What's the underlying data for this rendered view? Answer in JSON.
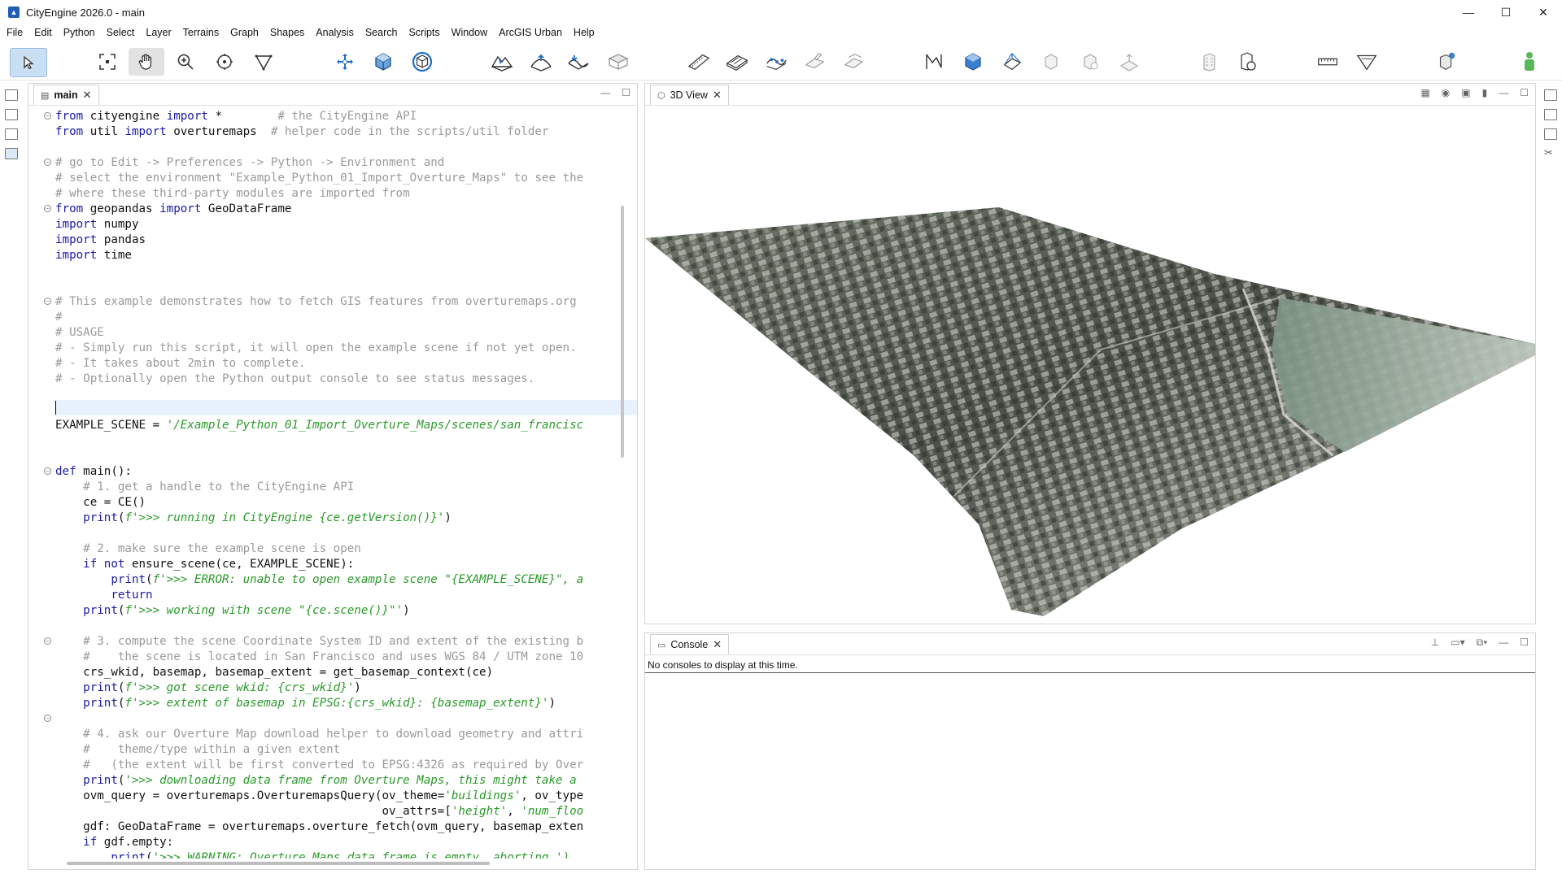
{
  "window": {
    "title": "CityEngine 2026.0 - main"
  },
  "menu": [
    "File",
    "Edit",
    "Python",
    "Select",
    "Layer",
    "Terrains",
    "Graph",
    "Shapes",
    "Analysis",
    "Search",
    "Scripts",
    "Window",
    "ArcGIS Urban",
    "Help"
  ],
  "editor": {
    "tab_label": "main",
    "lines": [
      [
        {
          "t": "from ",
          "c": "kw"
        },
        {
          "t": "cityengine ",
          "c": ""
        },
        {
          "t": "import",
          "c": "kw"
        },
        {
          "t": " *        ",
          "c": ""
        },
        {
          "t": "# the CityEngine API",
          "c": "cm"
        }
      ],
      [
        {
          "t": "from ",
          "c": "kw"
        },
        {
          "t": "util ",
          "c": ""
        },
        {
          "t": "import",
          "c": "kw"
        },
        {
          "t": " overturemaps  ",
          "c": ""
        },
        {
          "t": "# helper code in the scripts/util folder",
          "c": "cm"
        }
      ],
      [],
      [
        {
          "t": "# go to Edit -> Preferences -> Python -> Environment and",
          "c": "cm"
        }
      ],
      [
        {
          "t": "# select the environment \"Example_Python_01_Import_Overture_Maps\" to see the",
          "c": "cm"
        }
      ],
      [
        {
          "t": "# where these third-party modules are imported from",
          "c": "cm"
        }
      ],
      [
        {
          "t": "from ",
          "c": "kw"
        },
        {
          "t": "geopandas ",
          "c": ""
        },
        {
          "t": "import",
          "c": "kw"
        },
        {
          "t": " GeoDataFrame",
          "c": ""
        }
      ],
      [
        {
          "t": "import",
          "c": "kw"
        },
        {
          "t": " numpy",
          "c": ""
        }
      ],
      [
        {
          "t": "import",
          "c": "kw"
        },
        {
          "t": " pandas",
          "c": ""
        }
      ],
      [
        {
          "t": "import",
          "c": "kw"
        },
        {
          "t": " time",
          "c": ""
        }
      ],
      [],
      [],
      [
        {
          "t": "# This example demonstrates how to fetch GIS features from overturemaps.org",
          "c": "cm"
        }
      ],
      [
        {
          "t": "#",
          "c": "cm"
        }
      ],
      [
        {
          "t": "# USAGE",
          "c": "cm"
        }
      ],
      [
        {
          "t": "# - Simply run this script, it will open the example scene if not yet open.",
          "c": "cm"
        }
      ],
      [
        {
          "t": "# - It takes about 2min to complete.",
          "c": "cm"
        }
      ],
      [
        {
          "t": "# - Optionally open the Python output console to see status messages.",
          "c": "cm"
        }
      ],
      [],
      [],
      [
        {
          "t": "EXAMPLE_SCENE = ",
          "c": ""
        },
        {
          "t": "'/Example_Python_01_Import_Overture_Maps/scenes/san_francisc",
          "c": "str"
        }
      ],
      [],
      [],
      [
        {
          "t": "def ",
          "c": "kw"
        },
        {
          "t": "main():",
          "c": ""
        }
      ],
      [
        {
          "t": "    # 1. get a handle to the CityEngine API",
          "c": "cm"
        }
      ],
      [
        {
          "t": "    ce = CE()",
          "c": ""
        }
      ],
      [
        {
          "t": "    print",
          "c": "df"
        },
        {
          "t": "(",
          "c": ""
        },
        {
          "t": "f'>>> running in CityEngine {ce.getVersion()}'",
          "c": "str"
        },
        {
          "t": ")",
          "c": ""
        }
      ],
      [],
      [
        {
          "t": "    # 2. make sure the example scene is open",
          "c": "cm"
        }
      ],
      [
        {
          "t": "    if not ",
          "c": "kw"
        },
        {
          "t": "ensure_scene(ce, EXAMPLE_SCENE):",
          "c": ""
        }
      ],
      [
        {
          "t": "        print",
          "c": "df"
        },
        {
          "t": "(",
          "c": ""
        },
        {
          "t": "f'>>> ERROR: unable to open example scene \"{EXAMPLE_SCENE}\", a",
          "c": "str"
        }
      ],
      [
        {
          "t": "        return",
          "c": "kw"
        }
      ],
      [
        {
          "t": "    print",
          "c": "df"
        },
        {
          "t": "(",
          "c": ""
        },
        {
          "t": "f'>>> working with scene \"{ce.scene()}\"'",
          "c": "str"
        },
        {
          "t": ")",
          "c": ""
        }
      ],
      [],
      [
        {
          "t": "    # 3. compute the scene Coordinate System ID and extent of the existing b",
          "c": "cm"
        }
      ],
      [
        {
          "t": "    #    the scene is located in San Francisco and uses WGS 84 / UTM zone 10",
          "c": "cm"
        }
      ],
      [
        {
          "t": "    crs_wkid, basemap, basemap_extent = get_basemap_context(ce)",
          "c": ""
        }
      ],
      [
        {
          "t": "    print",
          "c": "df"
        },
        {
          "t": "(",
          "c": ""
        },
        {
          "t": "f'>>> got scene wkid: {crs_wkid}'",
          "c": "str"
        },
        {
          "t": ")",
          "c": ""
        }
      ],
      [
        {
          "t": "    print",
          "c": "df"
        },
        {
          "t": "(",
          "c": ""
        },
        {
          "t": "f'>>> extent of basemap in EPSG:{crs_wkid}: {basemap_extent}'",
          "c": "str"
        },
        {
          "t": ")",
          "c": ""
        }
      ],
      [],
      [
        {
          "t": "    # 4. ask our Overture Map download helper to download geometry and attri",
          "c": "cm"
        }
      ],
      [
        {
          "t": "    #    theme/type within a given extent",
          "c": "cm"
        }
      ],
      [
        {
          "t": "    #   (the extent will be first converted to EPSG:4326 as required by Over",
          "c": "cm"
        }
      ],
      [
        {
          "t": "    print",
          "c": "df"
        },
        {
          "t": "(",
          "c": ""
        },
        {
          "t": "'>>> downloading data frame from Overture Maps, this might take a",
          "c": "str"
        }
      ],
      [
        {
          "t": "    ovm_query = overturemaps.OverturemapsQuery(ov_theme=",
          "c": ""
        },
        {
          "t": "'buildings'",
          "c": "str"
        },
        {
          "t": ", ov_type",
          "c": ""
        }
      ],
      [
        {
          "t": "                                               ov_attrs=[",
          "c": ""
        },
        {
          "t": "'height'",
          "c": "str"
        },
        {
          "t": ", ",
          "c": ""
        },
        {
          "t": "'num_floo",
          "c": "str"
        }
      ],
      [
        {
          "t": "    gdf: GeoDataFrame = overturemaps.overture_fetch(ovm_query, basemap_exten",
          "c": ""
        }
      ],
      [
        {
          "t": "    if ",
          "c": "kw"
        },
        {
          "t": "gdf.empty:",
          "c": ""
        }
      ],
      [
        {
          "t": "        print",
          "c": "df"
        },
        {
          "t": "(",
          "c": ""
        },
        {
          "t": "'>>> WARNING: Overture Maps data frame is empty, aborting.')",
          "c": "str"
        }
      ]
    ]
  },
  "view3d": {
    "tab_label": "3D View"
  },
  "console": {
    "tab_label": "Console",
    "message": "No consoles to display at this time."
  },
  "colors": {
    "keyword": "#1a1aa6",
    "comment": "#9a9a9a",
    "string": "#2a9a2a",
    "selection": "#c9dff3",
    "accent": "#1f5fb4"
  },
  "icons": [
    "select-tool-icon",
    "frame-icon",
    "pan-hand-icon",
    "zoom-icon",
    "orbit-icon",
    "polygon-icon",
    "move-icon",
    "scale-cube-icon",
    "rotate-icon",
    "terrain-icon",
    "terrain-raise-icon",
    "terrain-lower-icon",
    "terrain-flatten-icon",
    "street-tool-icon",
    "lot-tool-icon",
    "street-network-icon",
    "shape-edit-icon",
    "shape-offset-icon",
    "ruler-icon",
    "cube-analysis-icon",
    "frustum-icon",
    "building-icon",
    "measure-icon",
    "polygon-shape-icon",
    "bucket-icon",
    "person-icon"
  ]
}
